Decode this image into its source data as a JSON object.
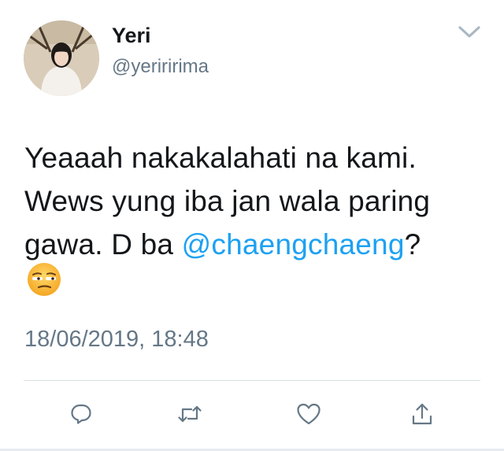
{
  "tweet": {
    "author": {
      "display_name": "Yeri",
      "handle": "@yeriririma",
      "avatar_icon": "profile-photo"
    },
    "text_before_mention": "Yeaaah nakakalahati na kami. Wews yung iba jan wala paring gawa. D ba ",
    "mention": "@chaengchaeng",
    "text_after_mention": "?",
    "emoji": "unamused-face-emoji",
    "timestamp": "18/06/2019, 18:48",
    "menu_icon": "chevron-down-icon",
    "actions": [
      {
        "name": "reply",
        "icon": "speech-bubble-icon"
      },
      {
        "name": "retweet",
        "icon": "retweet-icon"
      },
      {
        "name": "like",
        "icon": "heart-icon"
      },
      {
        "name": "share",
        "icon": "share-icon"
      }
    ]
  },
  "colors": {
    "text": "#14171a",
    "secondary_text": "#657786",
    "mention": "#1da1f2",
    "divider": "#d9dfe3",
    "icon": "#657786"
  }
}
